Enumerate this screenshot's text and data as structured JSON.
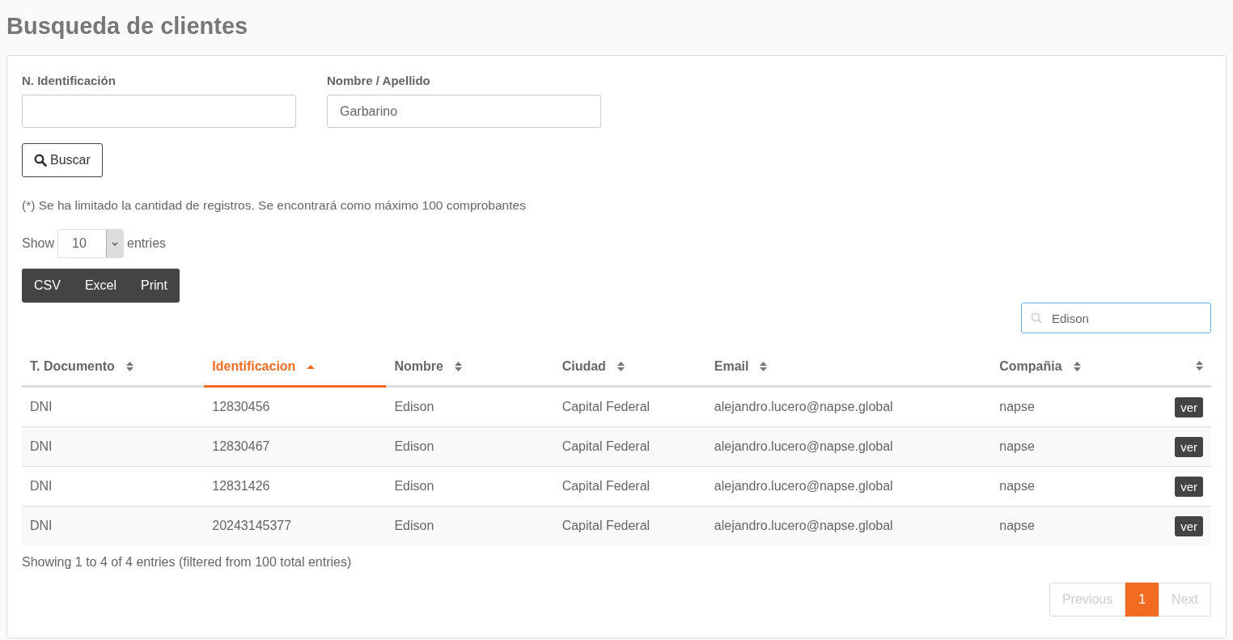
{
  "page_title": "Busqueda de clientes",
  "form": {
    "fields": [
      {
        "label": "N. Identificación"
      },
      {
        "label": "Nombre / Apellido",
        "value": "Garbarino"
      }
    ],
    "search_button": "Buscar",
    "notice": "(*) Se ha limitado la cantidad de registros. Se encontrará como máximo 100 comprobantes"
  },
  "length": {
    "prefix": "Show",
    "value": "10",
    "suffix": "entries"
  },
  "export_buttons": [
    "CSV",
    "Excel",
    "Print"
  ],
  "filter": {
    "value": "Edison"
  },
  "table": {
    "columns": [
      {
        "label": "T. Documento",
        "sorted": false
      },
      {
        "label": "Identificacion",
        "sorted": true
      },
      {
        "label": "Nombre",
        "sorted": false
      },
      {
        "label": "Ciudad",
        "sorted": false
      },
      {
        "label": "Email",
        "sorted": false
      },
      {
        "label": "Compañia",
        "sorted": false
      },
      {
        "sorted": false
      }
    ],
    "rows": [
      {
        "cells": [
          "DNI",
          "12830456",
          "Edison",
          "Capital Federal",
          "alejandro.lucero@napse.global",
          "napse"
        ],
        "action": "ver"
      },
      {
        "cells": [
          "DNI",
          "12830467",
          "Edison",
          "Capital Federal",
          "alejandro.lucero@napse.global",
          "napse"
        ],
        "action": "ver"
      },
      {
        "cells": [
          "DNI",
          "12831426",
          "Edison",
          "Capital Federal",
          "alejandro.lucero@napse.global",
          "napse"
        ],
        "action": "ver"
      },
      {
        "cells": [
          "DNI",
          "20243145377",
          "Edison",
          "Capital Federal",
          "alejandro.lucero@napse.global",
          "napse"
        ],
        "action": "ver"
      }
    ]
  },
  "info": "Showing 1 to 4 of 4 entries (filtered from 100 total entries)",
  "pagination": {
    "previous": {
      "label": "Previous",
      "disabled": true
    },
    "pages": [
      {
        "label": "1",
        "selected": true
      }
    ],
    "next": {
      "label": "Next",
      "disabled": true
    }
  }
}
